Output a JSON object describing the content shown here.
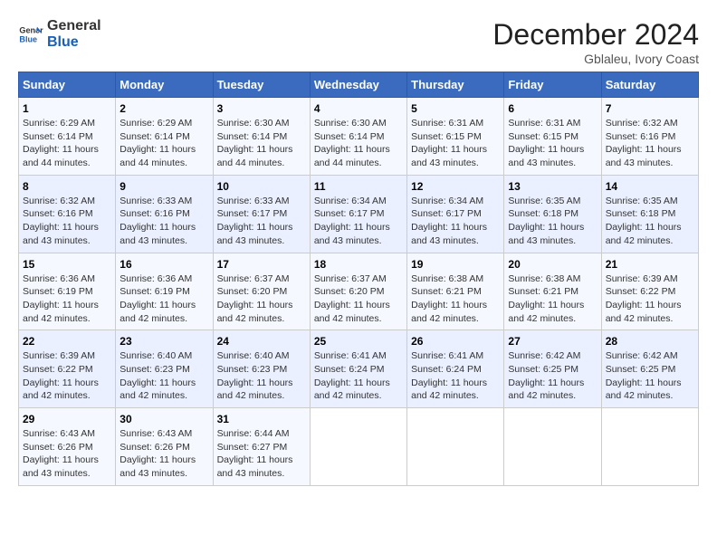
{
  "logo": {
    "text_general": "General",
    "text_blue": "Blue"
  },
  "header": {
    "title": "December 2024",
    "location": "Gblaleu, Ivory Coast"
  },
  "days_of_week": [
    "Sunday",
    "Monday",
    "Tuesday",
    "Wednesday",
    "Thursday",
    "Friday",
    "Saturday"
  ],
  "weeks": [
    [
      {
        "day": "1",
        "sunrise": "6:29 AM",
        "sunset": "6:14 PM",
        "daylight": "11 hours and 44 minutes."
      },
      {
        "day": "2",
        "sunrise": "6:29 AM",
        "sunset": "6:14 PM",
        "daylight": "11 hours and 44 minutes."
      },
      {
        "day": "3",
        "sunrise": "6:30 AM",
        "sunset": "6:14 PM",
        "daylight": "11 hours and 44 minutes."
      },
      {
        "day": "4",
        "sunrise": "6:30 AM",
        "sunset": "6:14 PM",
        "daylight": "11 hours and 44 minutes."
      },
      {
        "day": "5",
        "sunrise": "6:31 AM",
        "sunset": "6:15 PM",
        "daylight": "11 hours and 43 minutes."
      },
      {
        "day": "6",
        "sunrise": "6:31 AM",
        "sunset": "6:15 PM",
        "daylight": "11 hours and 43 minutes."
      },
      {
        "day": "7",
        "sunrise": "6:32 AM",
        "sunset": "6:16 PM",
        "daylight": "11 hours and 43 minutes."
      }
    ],
    [
      {
        "day": "8",
        "sunrise": "6:32 AM",
        "sunset": "6:16 PM",
        "daylight": "11 hours and 43 minutes."
      },
      {
        "day": "9",
        "sunrise": "6:33 AM",
        "sunset": "6:16 PM",
        "daylight": "11 hours and 43 minutes."
      },
      {
        "day": "10",
        "sunrise": "6:33 AM",
        "sunset": "6:17 PM",
        "daylight": "11 hours and 43 minutes."
      },
      {
        "day": "11",
        "sunrise": "6:34 AM",
        "sunset": "6:17 PM",
        "daylight": "11 hours and 43 minutes."
      },
      {
        "day": "12",
        "sunrise": "6:34 AM",
        "sunset": "6:17 PM",
        "daylight": "11 hours and 43 minutes."
      },
      {
        "day": "13",
        "sunrise": "6:35 AM",
        "sunset": "6:18 PM",
        "daylight": "11 hours and 43 minutes."
      },
      {
        "day": "14",
        "sunrise": "6:35 AM",
        "sunset": "6:18 PM",
        "daylight": "11 hours and 42 minutes."
      }
    ],
    [
      {
        "day": "15",
        "sunrise": "6:36 AM",
        "sunset": "6:19 PM",
        "daylight": "11 hours and 42 minutes."
      },
      {
        "day": "16",
        "sunrise": "6:36 AM",
        "sunset": "6:19 PM",
        "daylight": "11 hours and 42 minutes."
      },
      {
        "day": "17",
        "sunrise": "6:37 AM",
        "sunset": "6:20 PM",
        "daylight": "11 hours and 42 minutes."
      },
      {
        "day": "18",
        "sunrise": "6:37 AM",
        "sunset": "6:20 PM",
        "daylight": "11 hours and 42 minutes."
      },
      {
        "day": "19",
        "sunrise": "6:38 AM",
        "sunset": "6:21 PM",
        "daylight": "11 hours and 42 minutes."
      },
      {
        "day": "20",
        "sunrise": "6:38 AM",
        "sunset": "6:21 PM",
        "daylight": "11 hours and 42 minutes."
      },
      {
        "day": "21",
        "sunrise": "6:39 AM",
        "sunset": "6:22 PM",
        "daylight": "11 hours and 42 minutes."
      }
    ],
    [
      {
        "day": "22",
        "sunrise": "6:39 AM",
        "sunset": "6:22 PM",
        "daylight": "11 hours and 42 minutes."
      },
      {
        "day": "23",
        "sunrise": "6:40 AM",
        "sunset": "6:23 PM",
        "daylight": "11 hours and 42 minutes."
      },
      {
        "day": "24",
        "sunrise": "6:40 AM",
        "sunset": "6:23 PM",
        "daylight": "11 hours and 42 minutes."
      },
      {
        "day": "25",
        "sunrise": "6:41 AM",
        "sunset": "6:24 PM",
        "daylight": "11 hours and 42 minutes."
      },
      {
        "day": "26",
        "sunrise": "6:41 AM",
        "sunset": "6:24 PM",
        "daylight": "11 hours and 42 minutes."
      },
      {
        "day": "27",
        "sunrise": "6:42 AM",
        "sunset": "6:25 PM",
        "daylight": "11 hours and 42 minutes."
      },
      {
        "day": "28",
        "sunrise": "6:42 AM",
        "sunset": "6:25 PM",
        "daylight": "11 hours and 42 minutes."
      }
    ],
    [
      {
        "day": "29",
        "sunrise": "6:43 AM",
        "sunset": "6:26 PM",
        "daylight": "11 hours and 43 minutes."
      },
      {
        "day": "30",
        "sunrise": "6:43 AM",
        "sunset": "6:26 PM",
        "daylight": "11 hours and 43 minutes."
      },
      {
        "day": "31",
        "sunrise": "6:44 AM",
        "sunset": "6:27 PM",
        "daylight": "11 hours and 43 minutes."
      },
      null,
      null,
      null,
      null
    ]
  ],
  "labels": {
    "sunrise": "Sunrise:",
    "sunset": "Sunset:",
    "daylight": "Daylight:"
  }
}
